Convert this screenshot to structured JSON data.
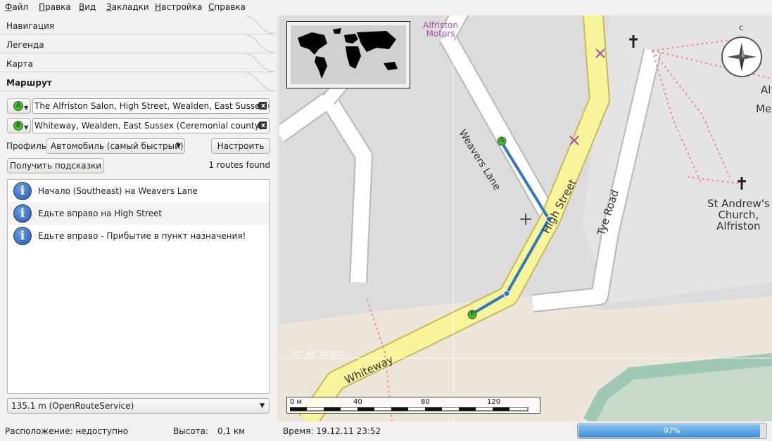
{
  "menu": [
    "Файл",
    "Правка",
    "Вид",
    "Закладки",
    "Настройка",
    "Справка"
  ],
  "sections": {
    "navigation": "Навигация",
    "legend": "Легенда",
    "map": "Карта",
    "route": "Маршрут"
  },
  "route": {
    "start": {
      "marker": "A",
      "value": "The Alfriston Salon, High Street, Wealden, East Sussex (Ce"
    },
    "end": {
      "marker": "B",
      "value": "Whiteway, Wealden, East Sussex (Ceremonial county), Sou"
    },
    "profile_label": "Профиль",
    "profile_value": "Автомобиль (самый быстрый)",
    "configure_button": "Настроить",
    "hints_button": "Получить подсказки",
    "routes_found": "1 routes found",
    "instructions": [
      "Начало (Southeast) на Weavers Lane",
      "Едьте вправо на High Street",
      "Едьте вправо - Прибытие в пункт назначения!"
    ],
    "selected_route": "135.1 m (OpenRouteService)"
  },
  "map": {
    "labels": {
      "alfriston_motors_1": "Alfriston",
      "alfriston_motors_2": "Motors",
      "weavers_lane": "Weavers Lane",
      "high_street": "High Street",
      "tye_road": "Tye Road",
      "whiteway": "Whiteway",
      "church_1": "St Andrew's",
      "church_2": "Church,",
      "church_3": "Alfriston",
      "alf_partial": "Alf",
      "me_partial": "Me",
      "latitude": "50° 48' 20,0\"С"
    },
    "compass_n": "С",
    "scale_labels": [
      "0 м",
      "40",
      "80",
      "120"
    ],
    "markers": {
      "a": "A",
      "b": "B"
    },
    "colors": {
      "route": "#2f78bd",
      "primary_road": "#f7f49b",
      "road": "#ffffff",
      "land": "#dcdcdc"
    }
  },
  "status": {
    "location": "Расположение: недоступно",
    "altitude_label": "Высота:",
    "altitude_value": "0,1 км",
    "time": "Время: 19.12.11 23:52",
    "progress_percent": 97,
    "progress_label": "97%"
  }
}
